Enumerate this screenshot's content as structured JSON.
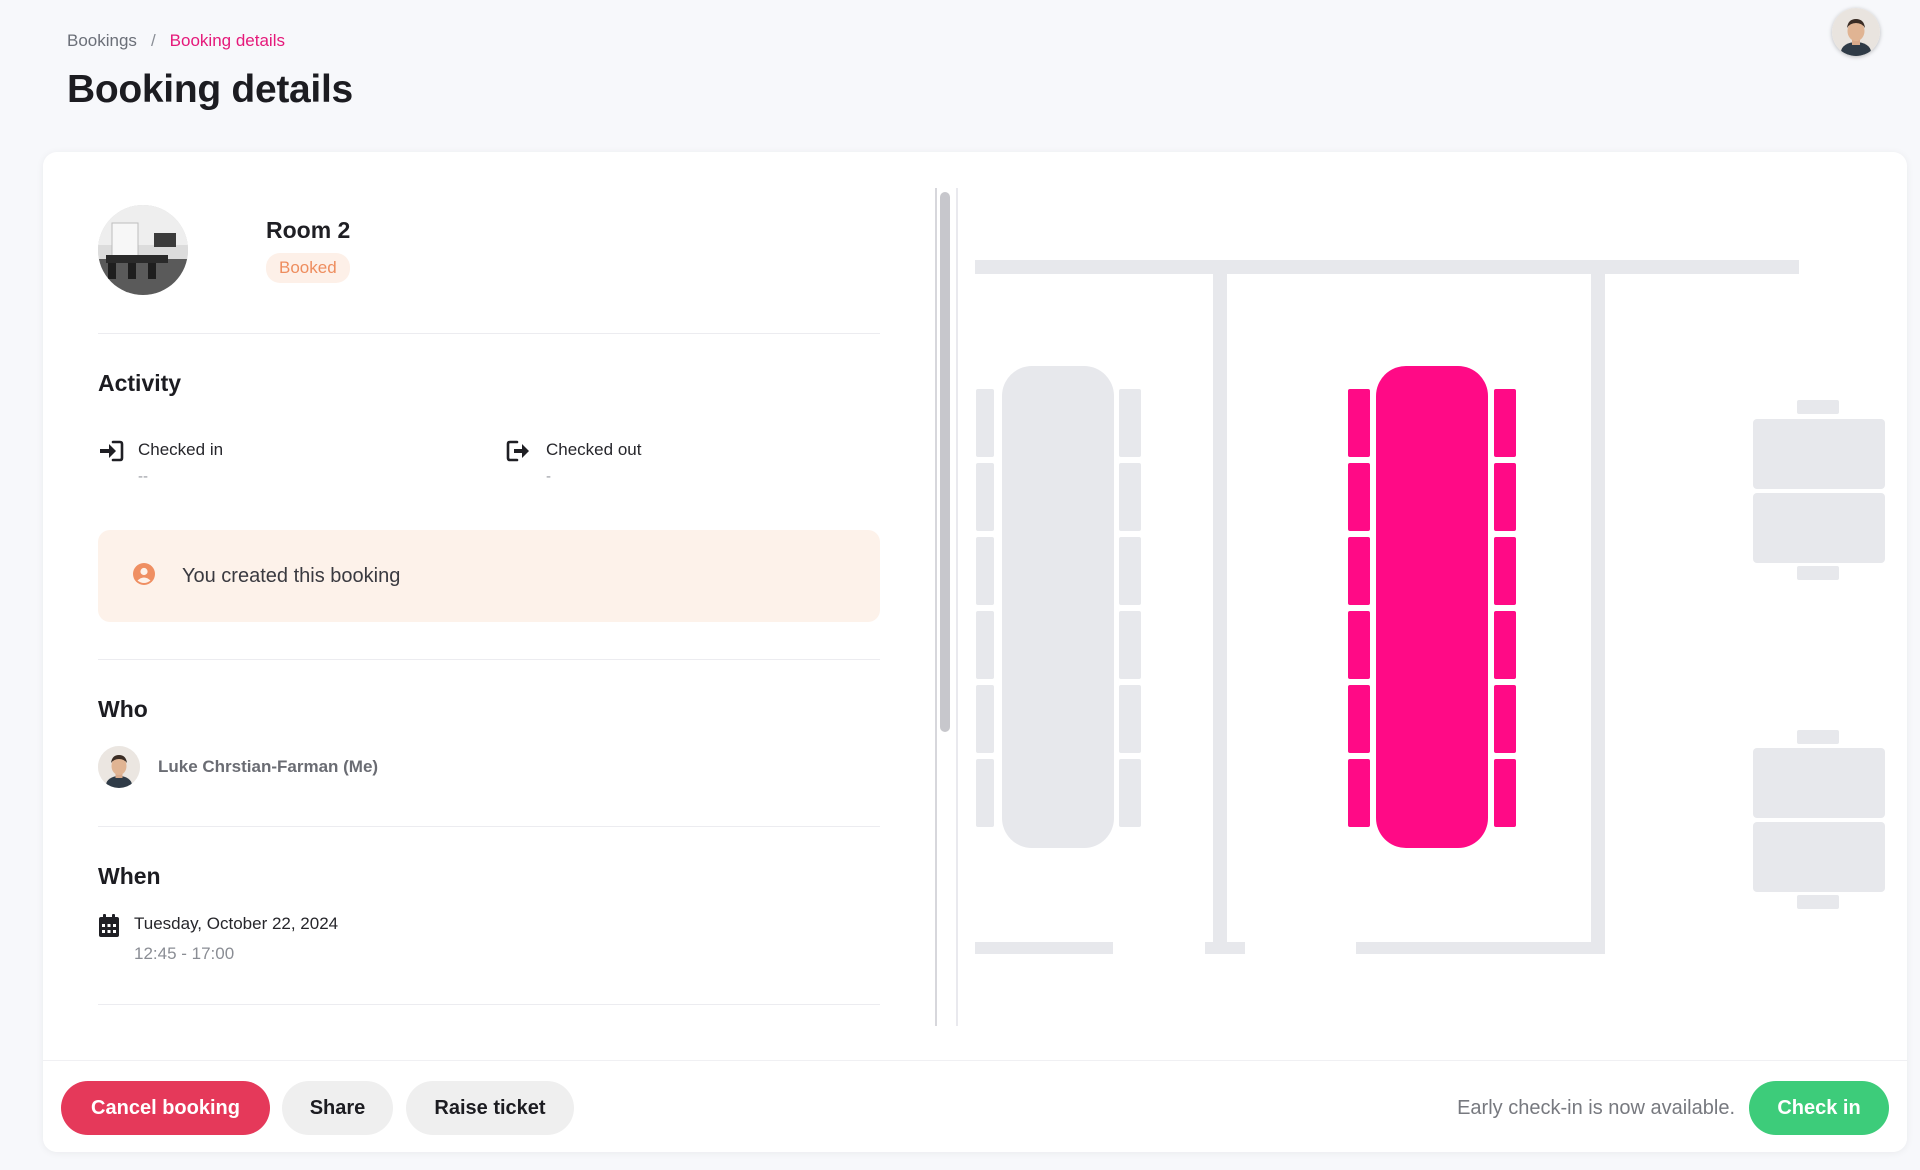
{
  "breadcrumb": {
    "parent": "Bookings",
    "separator": "/",
    "current": "Booking details"
  },
  "page_title": "Booking details",
  "room": {
    "name": "Room 2",
    "status": "Booked"
  },
  "activity": {
    "title": "Activity",
    "checked_in": {
      "label": "Checked in",
      "value": "--"
    },
    "checked_out": {
      "label": "Checked out",
      "value": "-"
    },
    "notice": "You created this booking"
  },
  "who": {
    "title": "Who",
    "name": "Luke Chrstian-Farman (Me)"
  },
  "when": {
    "title": "When",
    "date": "Tuesday, October 22, 2024",
    "time": "12:45 - 17:00"
  },
  "actions": {
    "cancel": "Cancel booking",
    "share": "Share",
    "raise_ticket": "Raise ticket",
    "early_checkin_text": "Early check-in is now available.",
    "check_in": "Check in"
  },
  "colors": {
    "accent": "#e5197a",
    "selected_room": "#ff0a86",
    "cancel": "#e5395a",
    "check_in": "#3dcc7a",
    "booked_badge": "#ee8d5e",
    "floor_furniture": "#e7e8ec"
  },
  "icons": {
    "checked_in": "sign-in-icon",
    "checked_out": "sign-out-icon",
    "notice": "user-circle-icon",
    "when": "calendar-icon"
  }
}
